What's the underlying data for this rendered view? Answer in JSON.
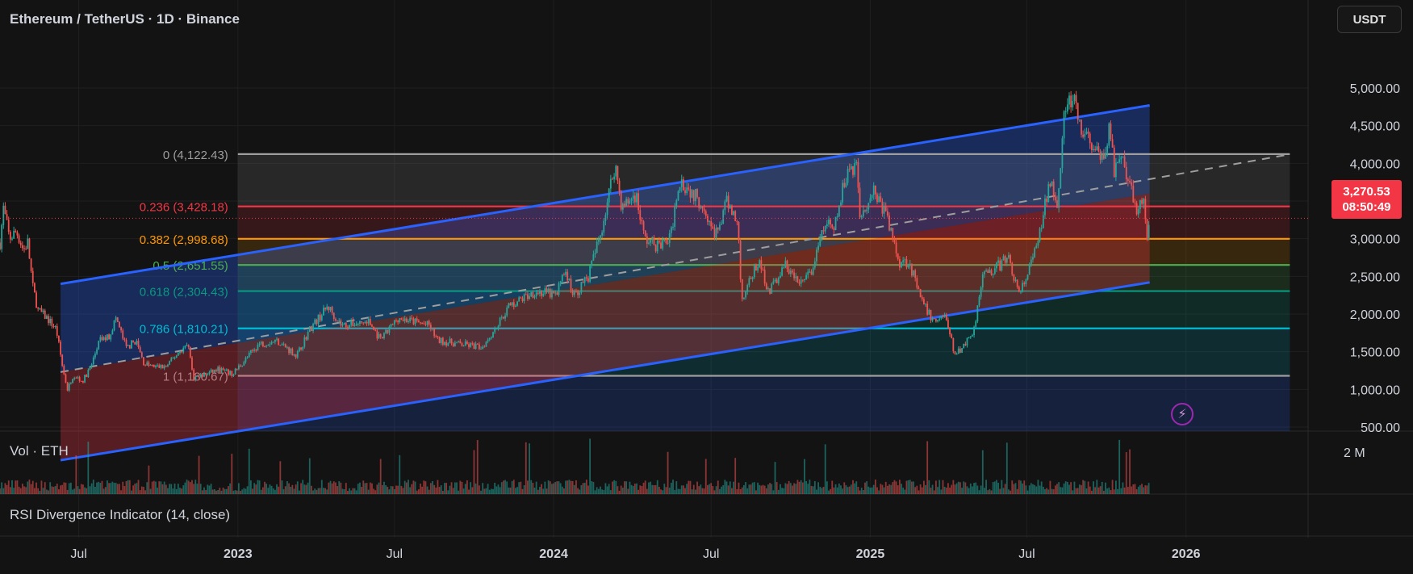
{
  "header": {
    "title": "Ethereum / TetherUS · 1D · Binance",
    "currency": "USDT"
  },
  "price_tag": {
    "price": "3,270.53",
    "countdown": "08:50:49"
  },
  "panes": {
    "volume_label": "Vol · ETH",
    "volume_axis_label": "2 M",
    "rsi_label": "RSI Divergence Indicator (14, close)"
  },
  "x_axis": {
    "labels": [
      "Jul",
      "2023",
      "Jul",
      "2024",
      "Jul",
      "2025",
      "Jul",
      "2026"
    ],
    "bold": [
      false,
      true,
      false,
      true,
      false,
      true,
      false,
      true
    ]
  },
  "colors": {
    "background": "#131313",
    "grid": "#1f1f1f",
    "candle_up": "#26a69a",
    "candle_down": "#ef5350",
    "channel": "#2962ff",
    "fib_0": "#9e9e9e",
    "fib_0236": "#f23645",
    "fib_0382": "#ff9800",
    "fib_05": "#4caf50",
    "fib_0618": "#089981",
    "fib_0786": "#00bcd4",
    "fib_1": "#9e9e9e"
  },
  "chart_data": {
    "type": "candlestick",
    "symbol": "Ethereum / TetherUS",
    "interval": "1D",
    "exchange": "Binance",
    "y_axis": {
      "ticks": [
        5000,
        4500,
        4000,
        3500,
        3000,
        2500,
        2000,
        1500,
        1000,
        500
      ],
      "tick_labels": [
        "5,000.00",
        "4,500.00",
        "4,000.00",
        "3,500.00",
        "3,000.00",
        "2,500.00",
        "2,000.00",
        "1,500.00",
        "1,000.00",
        "500.00"
      ],
      "range": [
        400,
        5150
      ]
    },
    "x_range": [
      "2022-04-01",
      "2026-05-10"
    ],
    "last_price": 3270.53,
    "fib_retracement": {
      "start_date": "2023-01-01",
      "end_date": "2026-05-01",
      "levels": [
        {
          "ratio": "0",
          "price": 4122.43,
          "label": "0 (4,122.43)",
          "color": "#9e9e9e"
        },
        {
          "ratio": "0.236",
          "price": 3428.18,
          "label": "0.236 (3,428.18)",
          "color": "#f23645"
        },
        {
          "ratio": "0.382",
          "price": 2998.68,
          "label": "0.382 (2,998.68)",
          "color": "#ff9800"
        },
        {
          "ratio": "0.5",
          "price": 2651.55,
          "label": "0.5 (2,651.55)",
          "color": "#4caf50"
        },
        {
          "ratio": "0.618",
          "price": 2304.43,
          "label": "0.618 (2,304.43)",
          "color": "#089981"
        },
        {
          "ratio": "0.786",
          "price": 1810.21,
          "label": "0.786 (1,810.21)",
          "color": "#00bcd4"
        },
        {
          "ratio": "1",
          "price": 1180.67,
          "label": "1 (1,180.67)",
          "color": "#9e9e9e"
        }
      ]
    },
    "regression_channel": {
      "start_date": "2022-06-10",
      "end_date": "2025-11-20",
      "upper": [
        2400,
        4770
      ],
      "mid": [
        1230,
        3600
      ],
      "lower": [
        60,
        2420
      ],
      "extended_mid_end": {
        "date": "2026-05-01",
        "price": 4120
      }
    },
    "price_path": [
      [
        "2022-04-01",
        2950
      ],
      [
        "2022-04-05",
        3400
      ],
      [
        "2022-04-12",
        3000
      ],
      [
        "2022-04-20",
        3100
      ],
      [
        "2022-04-28",
        2850
      ],
      [
        "2022-05-03",
        2950
      ],
      [
        "2022-05-09",
        2350
      ],
      [
        "2022-05-15",
        2050
      ],
      [
        "2022-05-25",
        1950
      ],
      [
        "2022-06-05",
        1800
      ],
      [
        "2022-06-13",
        1250
      ],
      [
        "2022-06-18",
        1000
      ],
      [
        "2022-06-25",
        1200
      ],
      [
        "2022-07-05",
        1100
      ],
      [
        "2022-07-15",
        1300
      ],
      [
        "2022-07-25",
        1650
      ],
      [
        "2022-08-05",
        1700
      ],
      [
        "2022-08-13",
        1950
      ],
      [
        "2022-08-25",
        1550
      ],
      [
        "2022-09-05",
        1650
      ],
      [
        "2022-09-14",
        1350
      ],
      [
        "2022-09-25",
        1300
      ],
      [
        "2022-10-10",
        1300
      ],
      [
        "2022-10-25",
        1500
      ],
      [
        "2022-11-05",
        1600
      ],
      [
        "2022-11-10",
        1150
      ],
      [
        "2022-11-25",
        1200
      ],
      [
        "2022-12-10",
        1270
      ],
      [
        "2022-12-25",
        1200
      ],
      [
        "2023-01-10",
        1400
      ],
      [
        "2023-01-25",
        1600
      ],
      [
        "2023-02-15",
        1650
      ],
      [
        "2023-03-10",
        1450
      ],
      [
        "2023-03-25",
        1800
      ],
      [
        "2023-04-15",
        2100
      ],
      [
        "2023-05-01",
        1850
      ],
      [
        "2023-06-01",
        1900
      ],
      [
        "2023-06-15",
        1650
      ],
      [
        "2023-07-05",
        1950
      ],
      [
        "2023-08-10",
        1850
      ],
      [
        "2023-08-20",
        1650
      ],
      [
        "2023-09-15",
        1600
      ],
      [
        "2023-10-10",
        1560
      ],
      [
        "2023-10-25",
        1800
      ],
      [
        "2023-11-10",
        2100
      ],
      [
        "2023-12-10",
        2300
      ],
      [
        "2024-01-05",
        2250
      ],
      [
        "2024-01-12",
        2600
      ],
      [
        "2024-01-25",
        2250
      ],
      [
        "2024-02-10",
        2500
      ],
      [
        "2024-02-25",
        3100
      ],
      [
        "2024-03-12",
        4000
      ],
      [
        "2024-03-20",
        3400
      ],
      [
        "2024-04-05",
        3600
      ],
      [
        "2024-04-15",
        3000
      ],
      [
        "2024-05-01",
        2900
      ],
      [
        "2024-05-15",
        3000
      ],
      [
        "2024-05-25",
        3800
      ],
      [
        "2024-06-10",
        3600
      ],
      [
        "2024-06-25",
        3400
      ],
      [
        "2024-07-05",
        3000
      ],
      [
        "2024-07-20",
        3500
      ],
      [
        "2024-08-01",
        3200
      ],
      [
        "2024-08-05",
        2200
      ],
      [
        "2024-08-25",
        2700
      ],
      [
        "2024-09-06",
        2300
      ],
      [
        "2024-09-25",
        2650
      ],
      [
        "2024-10-10",
        2400
      ],
      [
        "2024-10-25",
        2550
      ],
      [
        "2024-11-10",
        3200
      ],
      [
        "2024-11-20",
        3100
      ],
      [
        "2024-12-05",
        3900
      ],
      [
        "2024-12-16",
        4000
      ],
      [
        "2024-12-20",
        3300
      ],
      [
        "2025-01-05",
        3650
      ],
      [
        "2025-01-20",
        3300
      ],
      [
        "2025-02-03",
        2700
      ],
      [
        "2025-02-15",
        2700
      ],
      [
        "2025-02-28",
        2200
      ],
      [
        "2025-03-15",
        1900
      ],
      [
        "2025-03-28",
        2000
      ],
      [
        "2025-04-09",
        1450
      ],
      [
        "2025-04-20",
        1600
      ],
      [
        "2025-05-01",
        1800
      ],
      [
        "2025-05-10",
        2500
      ],
      [
        "2025-05-25",
        2600
      ],
      [
        "2025-06-10",
        2750
      ],
      [
        "2025-06-22",
        2250
      ],
      [
        "2025-07-01",
        2500
      ],
      [
        "2025-07-15",
        3000
      ],
      [
        "2025-07-28",
        3800
      ],
      [
        "2025-08-05",
        3500
      ],
      [
        "2025-08-14",
        4700
      ],
      [
        "2025-08-24",
        4850
      ],
      [
        "2025-09-01",
        4400
      ],
      [
        "2025-09-10",
        4350
      ],
      [
        "2025-09-25",
        4000
      ],
      [
        "2025-10-05",
        4500
      ],
      [
        "2025-10-10",
        3900
      ],
      [
        "2025-10-20",
        4000
      ],
      [
        "2025-11-04",
        3400
      ],
      [
        "2025-11-12",
        3550
      ],
      [
        "2025-11-17",
        3050
      ],
      [
        "2025-11-20",
        3270
      ]
    ]
  }
}
